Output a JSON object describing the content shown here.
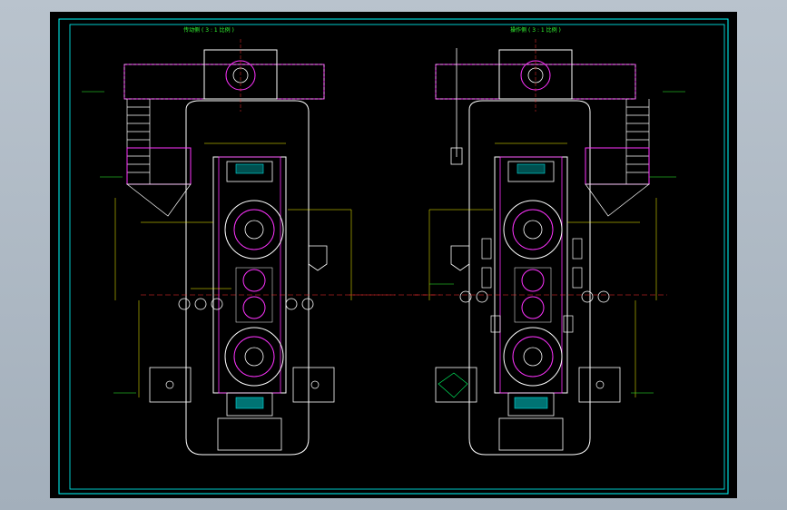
{
  "drawing": {
    "left_view_title": "传动侧 ( 3 : 1 比例 )",
    "right_view_title": "操作侧 ( 3 : 1 比例 )"
  },
  "colors": {
    "background": "#000000",
    "frame": "#00ffff",
    "outline": "#ffffff",
    "parts": "#ff33ff",
    "dimensions": "#ffff00",
    "text": "#33ff33",
    "hatch": "#00e5e5",
    "center_lines": "#ff3333"
  }
}
